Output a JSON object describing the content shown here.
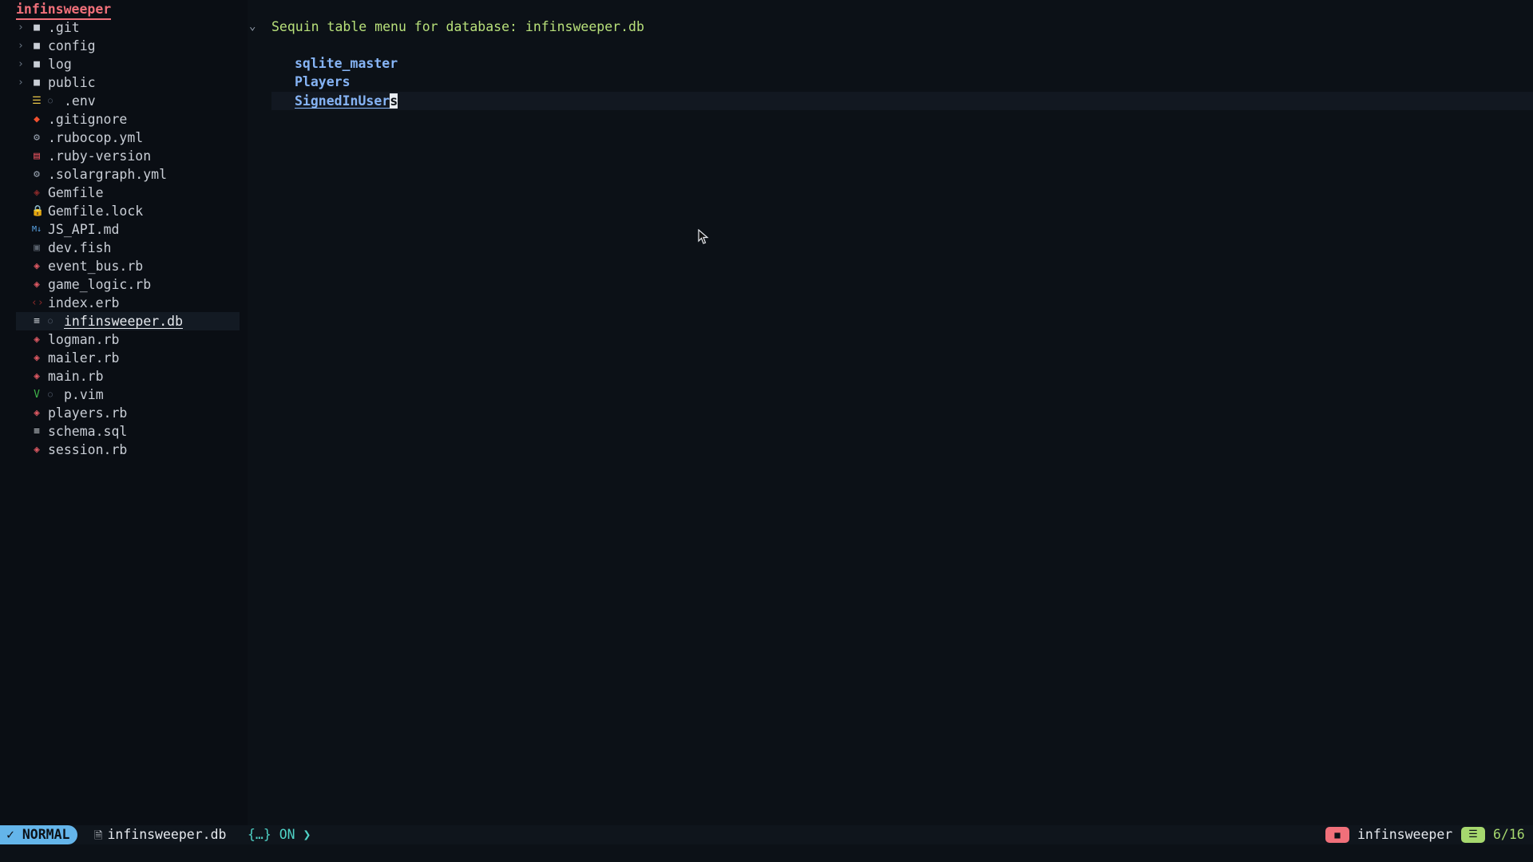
{
  "tree": {
    "root": "infinsweeper",
    "items": [
      {
        "name": ".git",
        "kind": "folder",
        "icon": "folder-icon",
        "color": "#c9ced6"
      },
      {
        "name": "config",
        "kind": "folder",
        "icon": "folder-icon",
        "color": "#c9ced6"
      },
      {
        "name": "log",
        "kind": "folder",
        "icon": "folder-icon",
        "color": "#c9ced6"
      },
      {
        "name": "public",
        "kind": "folder",
        "icon": "folder-icon",
        "color": "#c9ced6"
      },
      {
        "name": ".env",
        "kind": "file",
        "icon": "settings-sliders-icon",
        "color": "#e8c547",
        "git": "○"
      },
      {
        "name": ".gitignore",
        "kind": "file",
        "icon": "git-diamond-icon",
        "color": "#f1502f"
      },
      {
        "name": ".rubocop.yml",
        "kind": "file",
        "icon": "gear-icon",
        "color": "#9aa4b2"
      },
      {
        "name": ".ruby-version",
        "kind": "file",
        "icon": "document-icon",
        "color": "#e0505b"
      },
      {
        "name": ".solargraph.yml",
        "kind": "file",
        "icon": "gear-icon",
        "color": "#9aa4b2"
      },
      {
        "name": "Gemfile",
        "kind": "file",
        "icon": "ruby-icon",
        "color": "#8a2a2a"
      },
      {
        "name": "Gemfile.lock",
        "kind": "file",
        "icon": "lock-icon",
        "color": "#e05a64"
      },
      {
        "name": "JS_API.md",
        "kind": "file",
        "icon": "markdown-icon",
        "color": "#5aa5e8"
      },
      {
        "name": "dev.fish",
        "kind": "file",
        "icon": "terminal-icon",
        "color": "#5a636e"
      },
      {
        "name": "event_bus.rb",
        "kind": "file",
        "icon": "ruby-icon",
        "color": "#e05a64"
      },
      {
        "name": "game_logic.rb",
        "kind": "file",
        "icon": "ruby-icon",
        "color": "#e05a64"
      },
      {
        "name": "index.erb",
        "kind": "file",
        "icon": "code-brackets-icon",
        "color": "#8a2a2a"
      },
      {
        "name": "infinsweeper.db",
        "kind": "file",
        "icon": "database-icon",
        "color": "#d6dae0",
        "git": "○",
        "selected": true
      },
      {
        "name": "logman.rb",
        "kind": "file",
        "icon": "ruby-icon",
        "color": "#e05a64"
      },
      {
        "name": "mailer.rb",
        "kind": "file",
        "icon": "ruby-icon",
        "color": "#e05a64"
      },
      {
        "name": "main.rb",
        "kind": "file",
        "icon": "ruby-icon",
        "color": "#e05a64"
      },
      {
        "name": "p.vim",
        "kind": "file",
        "icon": "vim-icon",
        "color": "#3fb44a",
        "git": "○"
      },
      {
        "name": "players.rb",
        "kind": "file",
        "icon": "ruby-icon",
        "color": "#e05a64"
      },
      {
        "name": "schema.sql",
        "kind": "file",
        "icon": "database-icon",
        "color": "#d6dae0"
      },
      {
        "name": "session.rb",
        "kind": "file",
        "icon": "ruby-icon",
        "color": "#e05a64"
      }
    ]
  },
  "editor": {
    "header": "Sequin table menu for database: infinsweeper.db",
    "tables": [
      "sqlite_master",
      "Players"
    ],
    "current_table": "SignedInUser",
    "current_table_caret_char": "s"
  },
  "status": {
    "mode": "NORMAL",
    "file": "infinsweeper.db",
    "json_status": "{…} ON ❯",
    "project": "infinsweeper",
    "position": "6/16"
  }
}
